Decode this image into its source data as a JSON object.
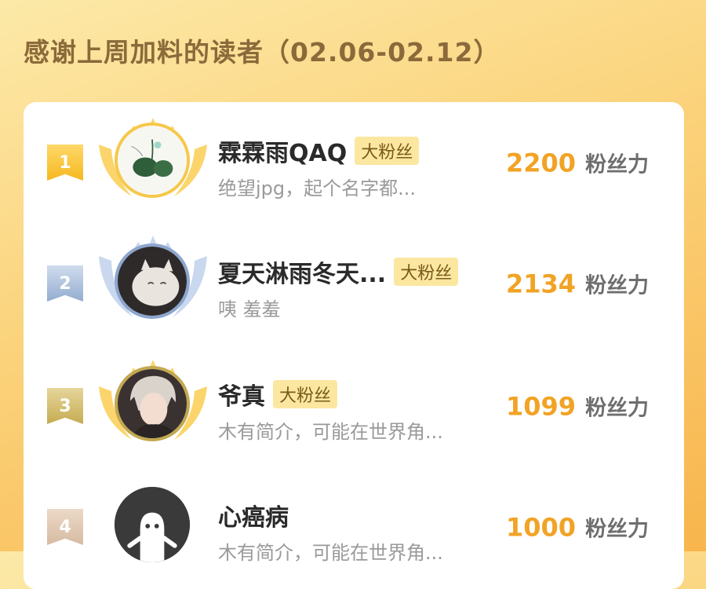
{
  "header": {
    "title": "感谢上周加料的读者（02.06-02.12）"
  },
  "readers": [
    {
      "rank": "1",
      "name": "霖霖雨QAQ",
      "badge": "大粉丝",
      "desc": "绝望jpg，起个名字都...",
      "score": "2200",
      "unit": "粉丝力",
      "medal": "gold",
      "avatar_icon": "lotus-painting-avatar"
    },
    {
      "rank": "2",
      "name": "夏天淋雨冬天...",
      "badge": "大粉丝",
      "desc": "咦 羞羞",
      "score": "2134",
      "unit": "粉丝力",
      "medal": "silver",
      "avatar_icon": "white-cat-avatar"
    },
    {
      "rank": "3",
      "name": "爷真",
      "badge": "大粉丝",
      "desc": "木有简介，可能在世界角...",
      "score": "1099",
      "unit": "粉丝力",
      "medal": "bronze",
      "avatar_icon": "anime-boy-avatar"
    },
    {
      "rank": "4",
      "name": "心癌病",
      "badge": "",
      "desc": "木有简介，可能在世界角...",
      "score": "1000",
      "unit": "粉丝力",
      "medal": "plain",
      "avatar_icon": "default-ghost-avatar"
    }
  ],
  "colors": {
    "score": "#f1a325",
    "gold": "#f6c84a",
    "silver": "#8ca6cf",
    "bronze": "#c2a850"
  }
}
